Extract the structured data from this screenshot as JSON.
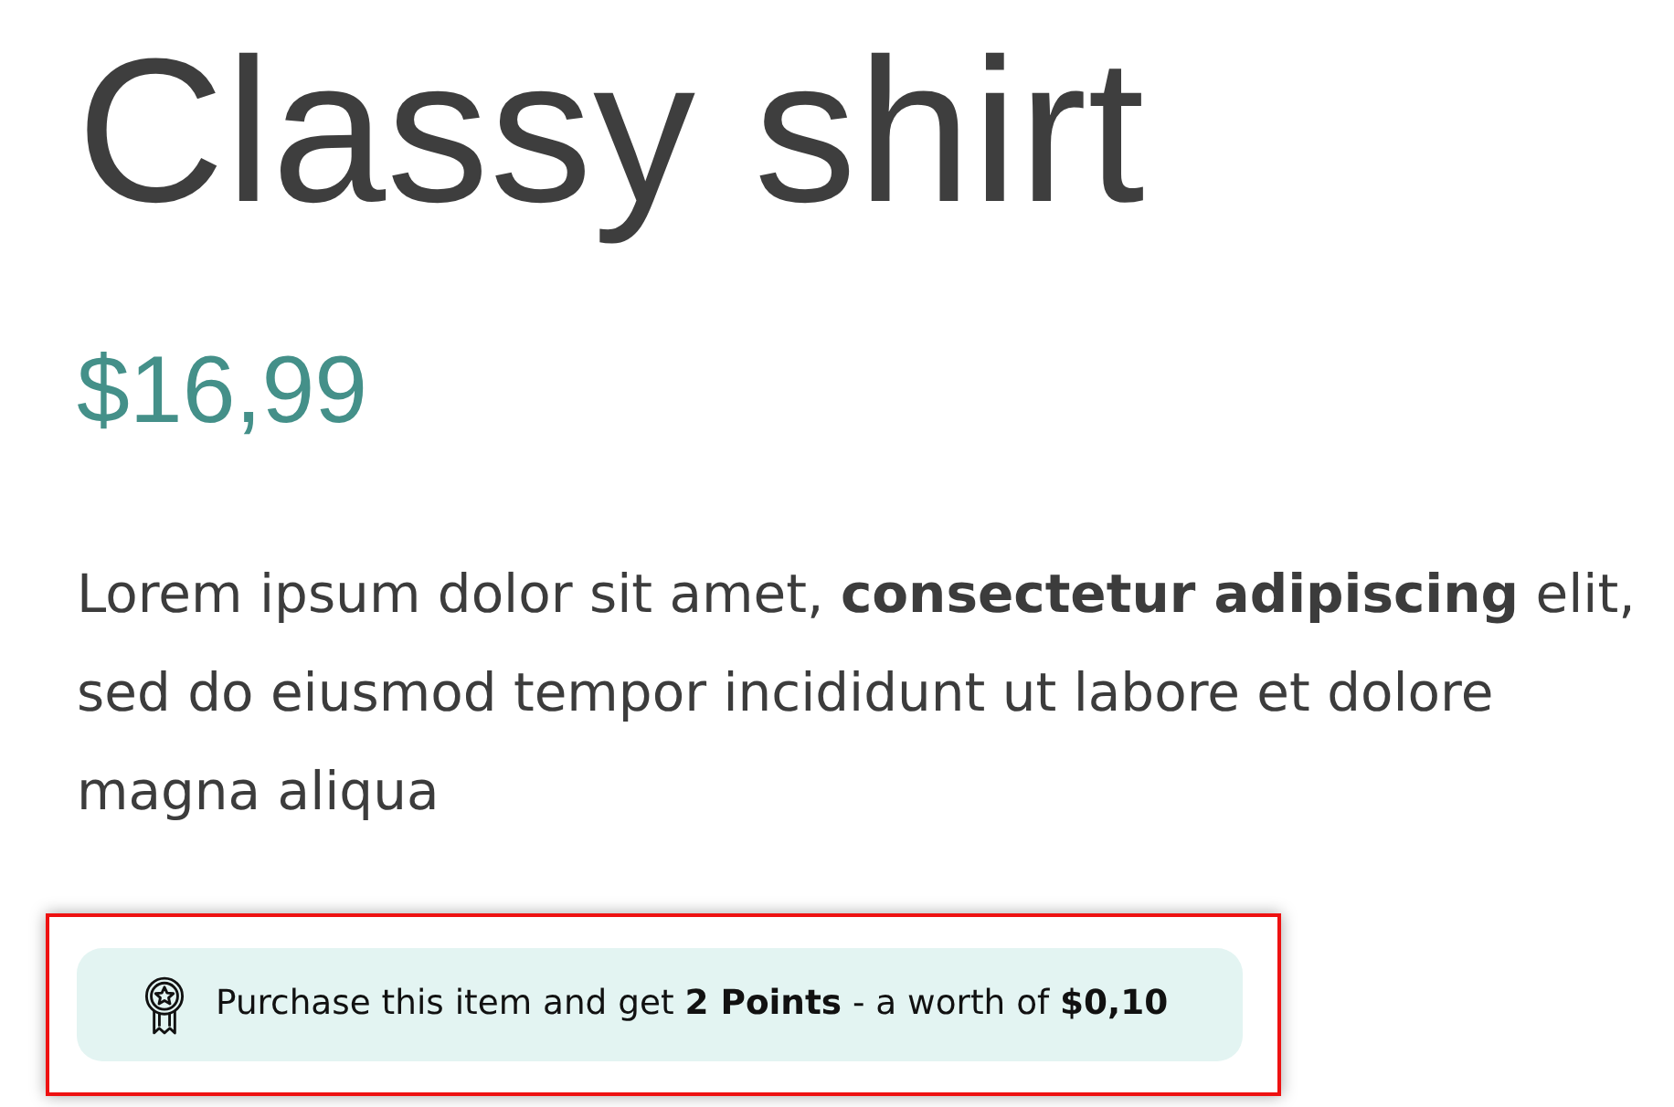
{
  "product": {
    "title": "Classy shirt",
    "price": "$16,99",
    "description": "Lorem ipsum dolor sit amet, **consectetur adipiscing** elit, sed do eiusmod tempor incididunt ut labore et dolore magna aliqua"
  },
  "points_notice": {
    "text": "Purchase this item and get **2 Points** - a worth of **$0,10**",
    "highlighted": true
  }
}
